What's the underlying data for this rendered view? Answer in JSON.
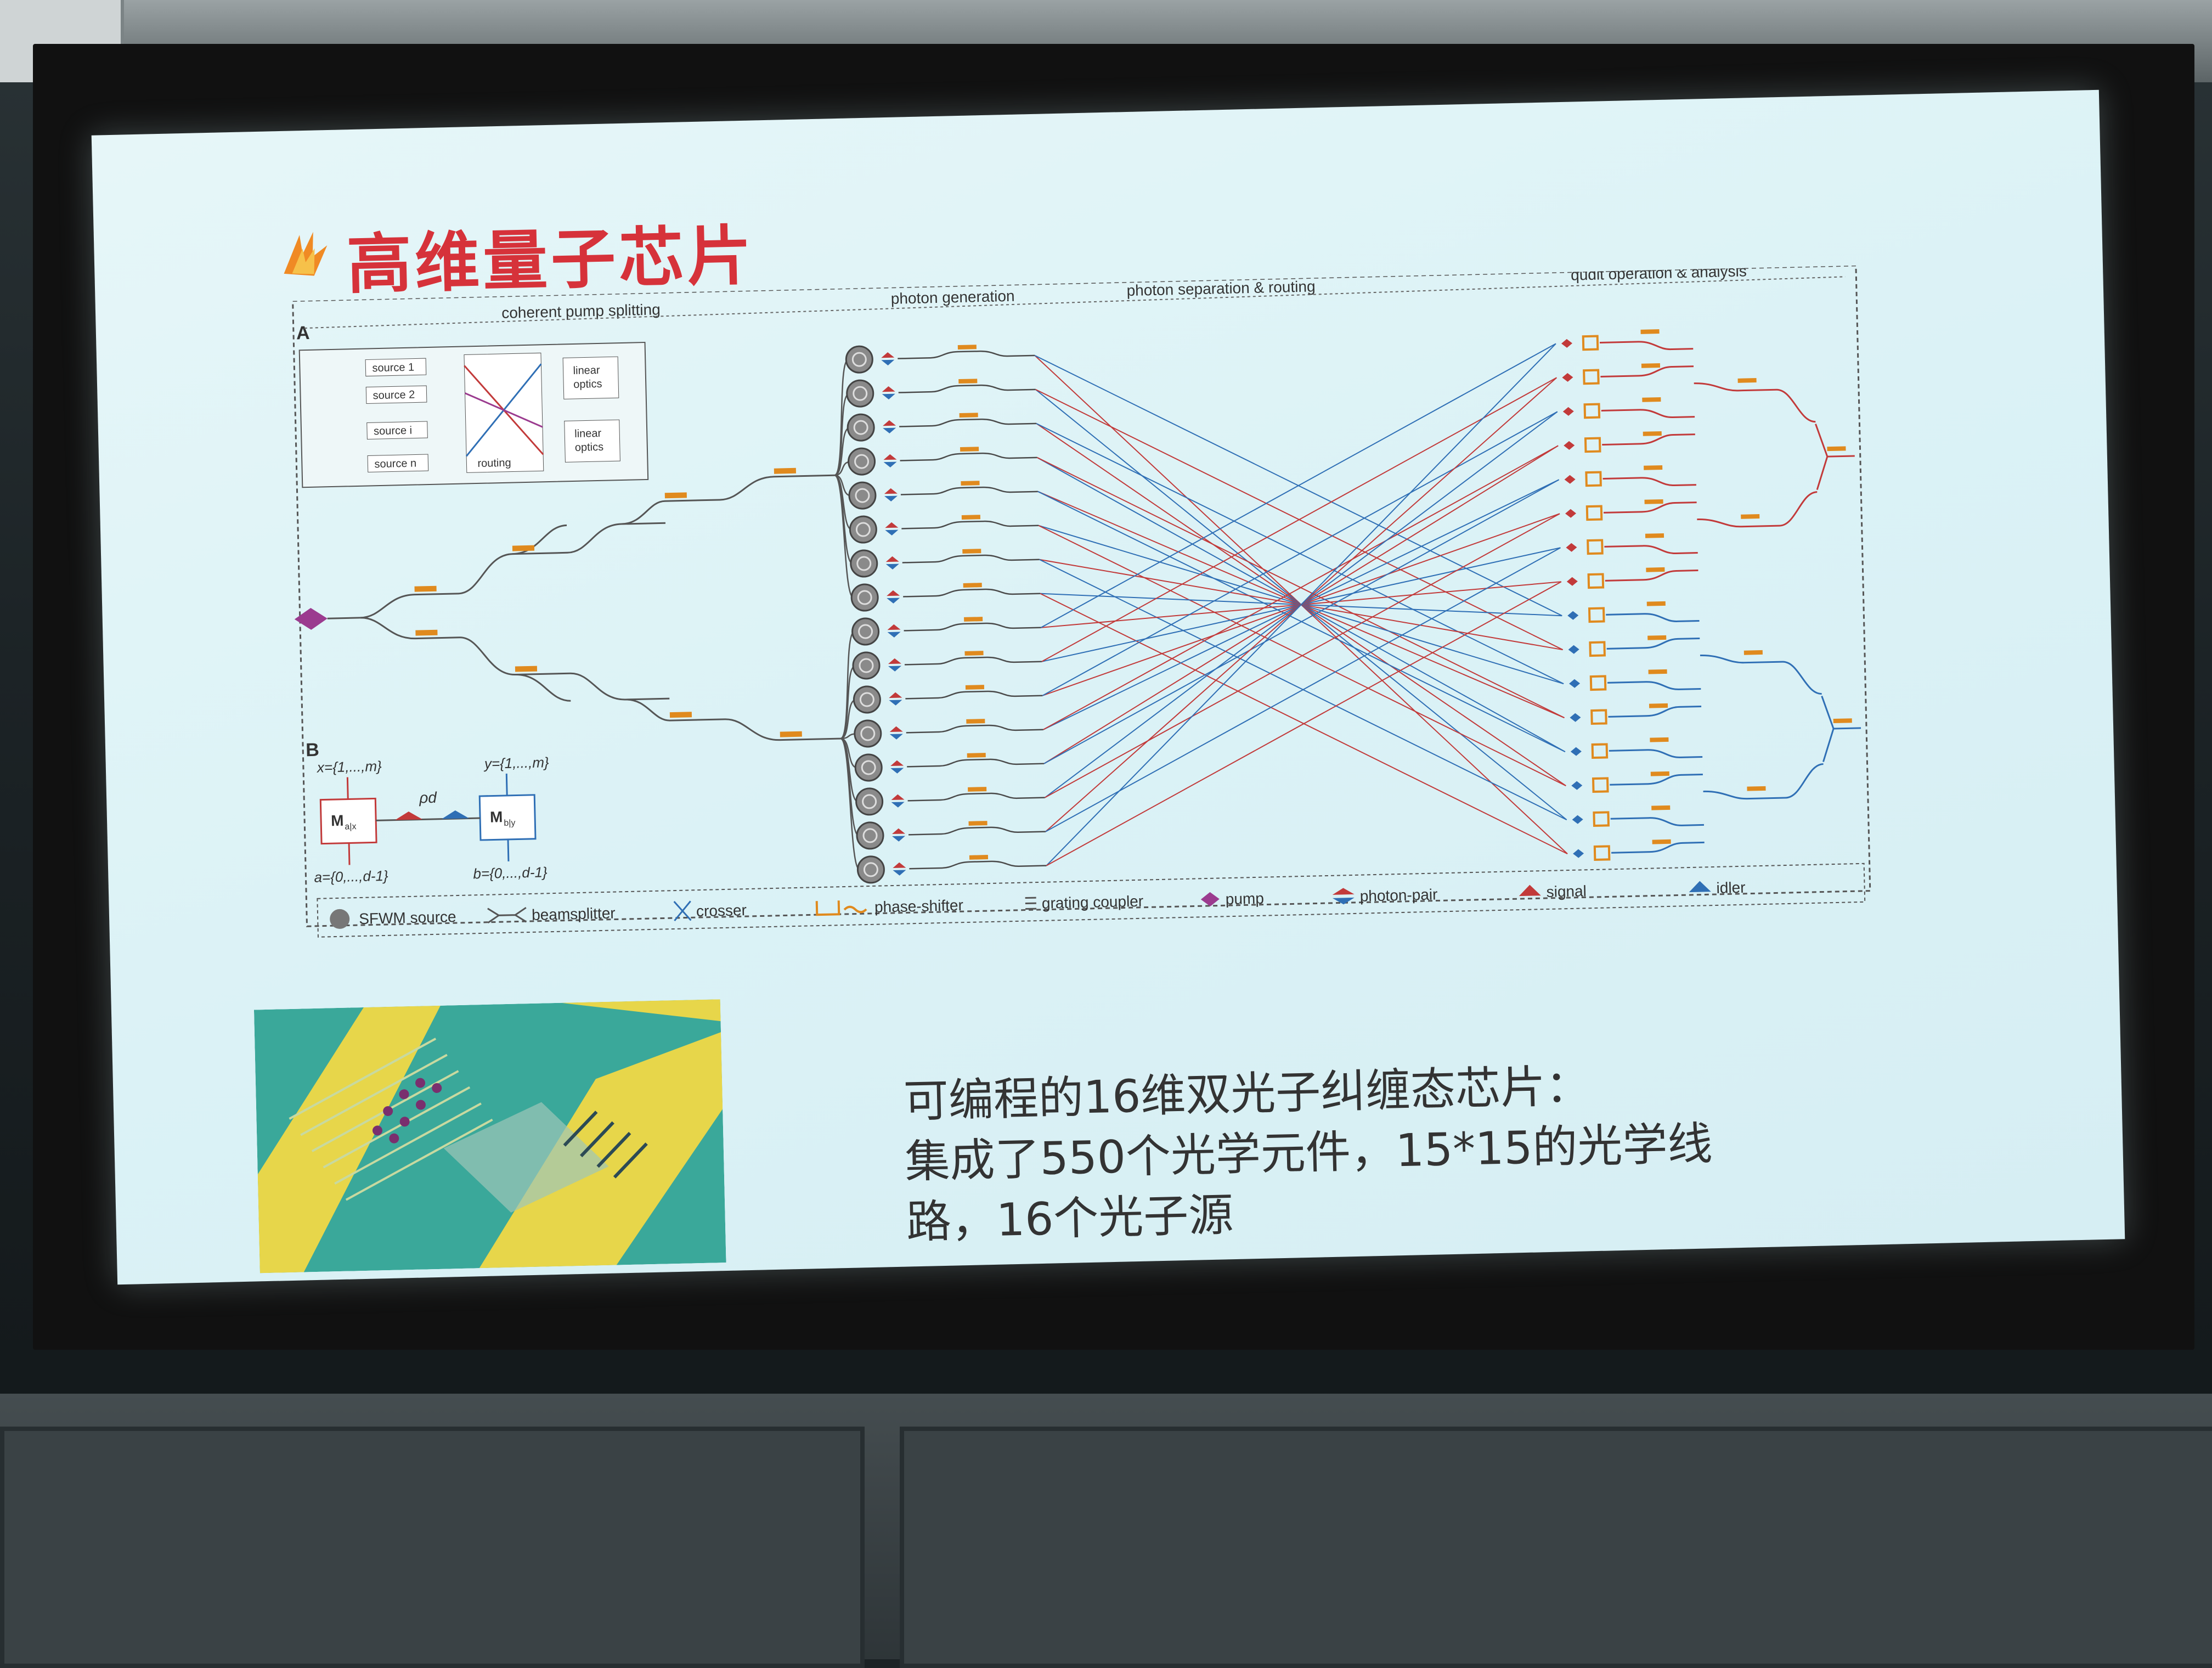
{
  "slide": {
    "title": "高维量子芯片",
    "caption_lines": [
      "可编程的16维双光子纠缠态芯片：",
      "集成了550个光学元件，15*15的光学线",
      "路，16个光子源"
    ]
  },
  "figure": {
    "panel_a": "A",
    "panel_b": "B",
    "section_headers": [
      "coherent pump splitting",
      "photon generation",
      "photon separation & routing",
      "qudit operation & analysis"
    ],
    "inset": {
      "sources": [
        "source 1",
        "source 2",
        "source i",
        "source n"
      ],
      "routing": "routing",
      "linear_optics": [
        "linear",
        "optics"
      ]
    },
    "panel_b_labels": {
      "x_set": "x={1,...,m}",
      "y_set": "y={1,...,m}",
      "a_set": "a={0,...,d-1}",
      "b_set": "b={0,...,d-1}",
      "m_left": "M",
      "m_left_sub": "a|x",
      "m_right": "M",
      "m_right_sub": "b|y",
      "rho": "ρd"
    },
    "legend": [
      {
        "label": "SFWM source",
        "icon": "spiral-source-icon"
      },
      {
        "label": "beamsplitter",
        "icon": "beamsplitter-icon"
      },
      {
        "label": "crosser",
        "icon": "crosser-icon"
      },
      {
        "label": "phase-shifter",
        "icon": "phase-shifter-icon"
      },
      {
        "label": "grating coupler",
        "icon": "grating-coupler-icon"
      },
      {
        "label": "pump",
        "icon": "pump-diamond-icon"
      },
      {
        "label": "photon-pair",
        "icon": "photon-pair-icon"
      },
      {
        "label": "signal",
        "icon": "signal-icon"
      },
      {
        "label": "idler",
        "icon": "idler-icon"
      }
    ],
    "colors": {
      "pump": "#9b3b8f",
      "signal": "#c23a3a",
      "idler": "#2f6fb5",
      "phase_shifter": "#e08a1e",
      "waveguide": "#4a4a4a"
    }
  }
}
